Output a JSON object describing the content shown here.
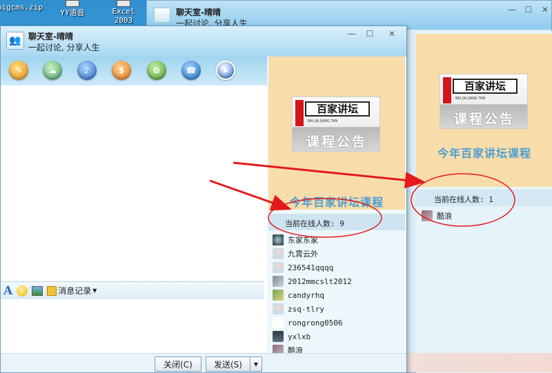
{
  "desktop": {
    "icons": [
      "pigcms.zip",
      "YY语音",
      "Excel 2003"
    ]
  },
  "back_window": {
    "title": "聊天室-晴晴",
    "subtitle": "一起讨论, 分享人生",
    "poster": {
      "logo_top": "百家讲坛",
      "logo_sub": "BAI JIA JIANG TAN",
      "logo_bottom": "课程公告",
      "caption": "今年百家讲坛课程"
    },
    "online_label": "当前在线人数: 1",
    "users": [
      {
        "name": "酷浪",
        "avatar": "photo-avatar"
      }
    ]
  },
  "front_window": {
    "title": "聊天室-晴晴",
    "subtitle": "一起讨论, 分享人生",
    "toolbar_icons": [
      "app-icon-1",
      "app-icon-2",
      "app-icon-3",
      "app-icon-4",
      "app-icon-5",
      "app-icon-6",
      "compass-icon"
    ],
    "input_toolbar": {
      "font_icon": "A",
      "history_label": "消息记录"
    },
    "poster": {
      "logo_top": "百家讲坛",
      "logo_sub": "BAI JIA JIANG TAN",
      "logo_bottom": "课程公告",
      "caption": "今年百家讲坛课程"
    },
    "online_label": "当前在线人数: 9",
    "users": [
      {
        "name": "东家东家",
        "avatar": "dark"
      },
      {
        "name": "九霄云外",
        "avatar": "default"
      },
      {
        "name": "236541qqqq",
        "avatar": "default"
      },
      {
        "name": "2012mmcslt2012",
        "avatar": "photo"
      },
      {
        "name": "candyrhq",
        "avatar": "green"
      },
      {
        "name": "zsq-tlry",
        "avatar": "default"
      },
      {
        "name": "rongrong0506",
        "avatar": "blank"
      },
      {
        "name": "yxlxb",
        "avatar": "dark"
      },
      {
        "name": "酷浪",
        "avatar": "photo"
      }
    ],
    "close_label": "关闭(C)",
    "send_label": "发送(S)"
  }
}
